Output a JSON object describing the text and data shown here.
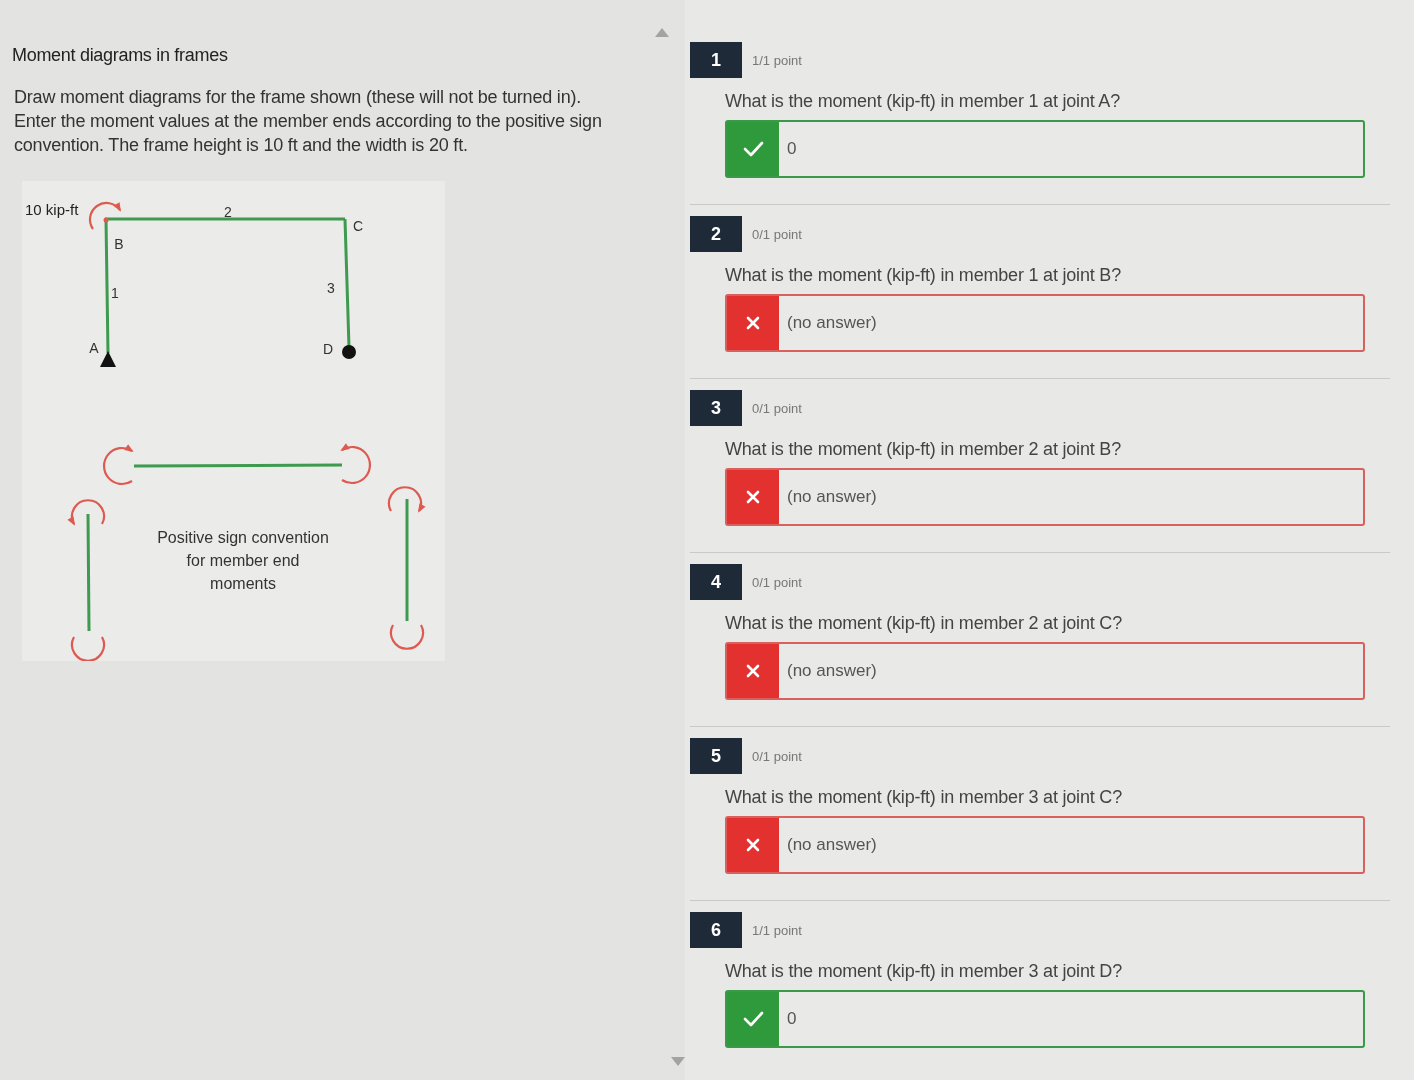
{
  "problem": {
    "title": "Moment diagrams in frames",
    "instructions": "Draw moment diagrams for the frame shown (these will not be turned in). Enter the moment values at the member ends according to the positive sign convention. The frame height is 10 ft and the width is 20 ft."
  },
  "figure": {
    "applied_moment": "10 kip-ft",
    "member_labels": [
      "1",
      "2",
      "3"
    ],
    "joint_labels": [
      "A",
      "B",
      "C",
      "D"
    ],
    "caption": "Positive sign convention for member end moments"
  },
  "questions": [
    {
      "number": "1",
      "score": "1/1 point",
      "prompt": "What is the moment (kip-ft) in member 1 at joint A?",
      "answer": "0",
      "correct": true
    },
    {
      "number": "2",
      "score": "0/1 point",
      "prompt": "What is the moment (kip-ft) in member 1 at joint B?",
      "answer": "(no answer)",
      "correct": false
    },
    {
      "number": "3",
      "score": "0/1 point",
      "prompt": "What is the moment (kip-ft) in member 2 at joint B?",
      "answer": "(no answer)",
      "correct": false
    },
    {
      "number": "4",
      "score": "0/1 point",
      "prompt": "What is the moment (kip-ft) in member 2 at joint C?",
      "answer": "(no answer)",
      "correct": false
    },
    {
      "number": "5",
      "score": "0/1 point",
      "prompt": "What is the moment (kip-ft) in member 3 at joint C?",
      "answer": "(no answer)",
      "correct": false
    },
    {
      "number": "6",
      "score": "1/1 point",
      "prompt": "What is the moment (kip-ft) in member 3 at joint D?",
      "answer": "0",
      "correct": true
    }
  ]
}
